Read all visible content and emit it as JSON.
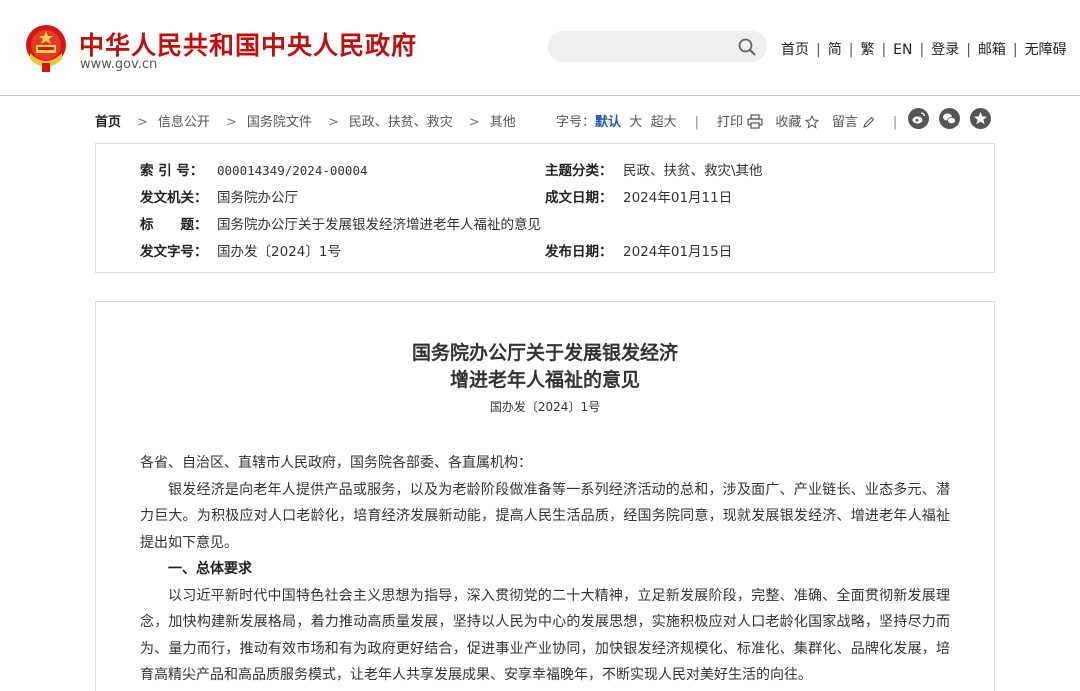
{
  "header": {
    "site_title": "中华人民共和国中央人民政府",
    "site_url": "www.gov.cn",
    "search_placeholder": "",
    "nav": [
      "首页",
      "简",
      "繁",
      "EN",
      "登录",
      "邮箱",
      "无障碍"
    ],
    "nav_separator": "|"
  },
  "breadcrumb": {
    "items": [
      "首页",
      "信息公开",
      "国务院文件",
      "民政、扶贫、救灾",
      "其他"
    ],
    "separator": ">"
  },
  "tools": {
    "font_label": "字号：",
    "font_default": "默认",
    "font_large": "大",
    "font_xlarge": "超大",
    "divider": "|",
    "print": "打印",
    "favorite": "收藏",
    "comment": "留言"
  },
  "social_icons": [
    "weibo-icon",
    "wechat-icon",
    "star-badge-icon"
  ],
  "info": {
    "index_label": "索 引 号：",
    "index_value": "000014349/2024-00004",
    "theme_label": "主题分类：",
    "theme_value": "民政、扶贫、救灾\\其他",
    "issuer_label": "发文机关：",
    "issuer_value": "国务院办公厅",
    "created_label": "成文日期：",
    "created_value": "2024年01月11日",
    "title_label": "标　　题：",
    "title_value": "国务院办公厅关于发展银发经济增进老年人福祉的意见",
    "docno_label": "发文字号：",
    "docno_value": "国办发〔2024〕1号",
    "published_label": "发布日期：",
    "published_value": "2024年01月15日"
  },
  "document": {
    "title_line1": "国务院办公厅关于发展银发经济",
    "title_line2": "增进老年人福祉的意见",
    "number": "国办发〔2024〕1号",
    "salutation": "各省、自治区、直辖市人民政府，国务院各部委、各直属机构：",
    "para1": "银发经济是向老年人提供产品或服务，以及为老龄阶段做准备等一系列经济活动的总和，涉及面广、产业链长、业态多元、潜力巨大。为积极应对人口老龄化，培育经济发展新动能，提高人民生活品质，经国务院同意，现就发展银发经济、增进老年人福祉提出如下意见。",
    "heading1": "一、总体要求",
    "para2": "以习近平新时代中国特色社会主义思想为指导，深入贯彻党的二十大精神，立足新发展阶段，完整、准确、全面贯彻新发展理念，加快构建新发展格局，着力推动高质量发展，坚持以人民为中心的发展思想，实施积极应对人口老龄化国家战略，坚持尽力而为、量力而行，推动有效市场和有为政府更好结合，促进事业产业协同，加快银发经济规模化、标准化、集群化、品牌化发展，培育高精尖产品和高品质服务模式，让老年人共享发展成果、安享幸福晚年，不断实现人民对美好生活的向往。"
  },
  "colors": {
    "brand_red": "#c00e0e",
    "link_blue": "#2158a8",
    "border": "#dcdcdc"
  }
}
